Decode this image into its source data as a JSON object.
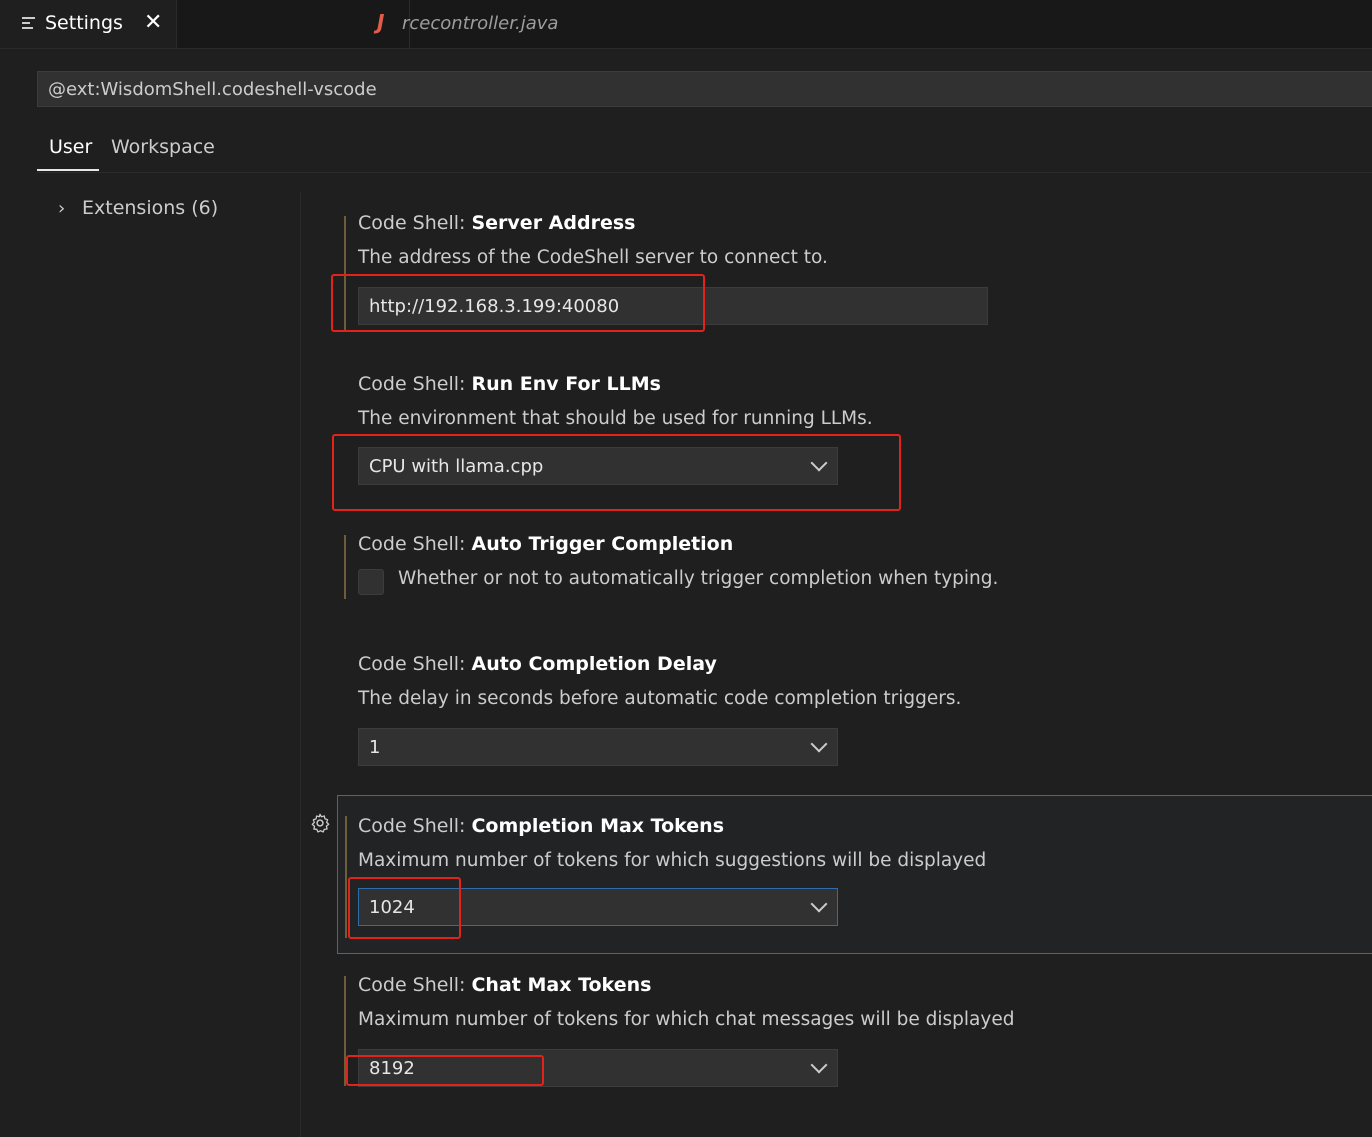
{
  "tabs": [
    {
      "label": "Settings",
      "active": true
    },
    {
      "label": "rcecontroller.java",
      "active": false,
      "icon": "java-icon"
    }
  ],
  "search": {
    "value": "@ext:WisdomShell.codeshell-vscode"
  },
  "scope_tabs": [
    {
      "label": "User",
      "selected": true
    },
    {
      "label": "Workspace",
      "selected": false
    }
  ],
  "toc": {
    "label": "Extensions (6)"
  },
  "settings": [
    {
      "category": "Code Shell: ",
      "key": "Server Address",
      "description": "The address of the CodeShell server to connect to.",
      "type": "text",
      "value": "http://192.168.3.199:40080"
    },
    {
      "category": "Code Shell: ",
      "key": "Run Env For LLMs",
      "description": "The environment that should be used for running LLMs.",
      "type": "select",
      "value": "CPU with llama.cpp"
    },
    {
      "category": "Code Shell: ",
      "key": "Auto Trigger Completion",
      "description": "Whether or not to automatically trigger completion when typing.",
      "type": "checkbox",
      "checked": false
    },
    {
      "category": "Code Shell: ",
      "key": "Auto Completion Delay",
      "description": "The delay in seconds before automatic code completion triggers.",
      "type": "select",
      "value": "1"
    },
    {
      "category": "Code Shell: ",
      "key": "Completion Max Tokens",
      "description": "Maximum number of tokens for which suggestions will be displayed",
      "type": "select",
      "value": "1024"
    },
    {
      "category": "Code Shell: ",
      "key": "Chat Max Tokens",
      "description": "Maximum number of tokens for which chat messages will be displayed",
      "type": "select",
      "value": "8192"
    }
  ],
  "colors": {
    "accent": "#2f6ca8",
    "annotation": "#e2231a",
    "modified": "#6e5d3b"
  }
}
